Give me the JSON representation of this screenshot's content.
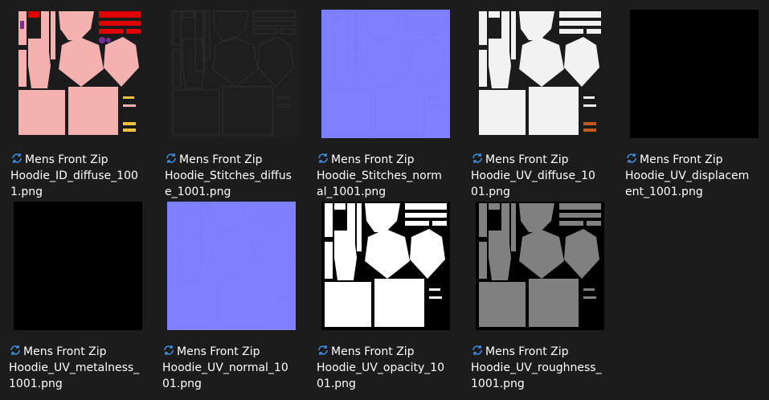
{
  "colors": {
    "background": "#1c1c1c",
    "text": "#ffffff",
    "sync_icon": "#3f8fe0",
    "id_pink": "#f5b0b0",
    "id_red": "#e00000",
    "id_purple": "#7b2e9a",
    "id_yellow": "#f0c040",
    "normal_blue": "#8080ff",
    "diffuse_white": "#f2f2f2",
    "roughness_gray": "#808080"
  },
  "icon": "sync-icon",
  "files": [
    {
      "lines": [
        "Mens Front Zip",
        "Hoodie_ID_diffuse_100",
        "1.png"
      ]
    },
    {
      "lines": [
        "Mens Front Zip",
        "Hoodie_Stitches_diffus",
        "e_1001.png"
      ]
    },
    {
      "lines": [
        "Mens Front Zip",
        "Hoodie_Stitches_norm",
        "al_1001.png"
      ]
    },
    {
      "lines": [
        "Mens Front Zip",
        "Hoodie_UV_diffuse_10",
        "01.png"
      ]
    },
    {
      "lines": [
        "Mens Front Zip",
        "Hoodie_UV_displacem",
        "ent_1001.png"
      ]
    },
    {
      "lines": [
        "Mens Front Zip",
        "Hoodie_UV_metalness_",
        "1001.png"
      ]
    },
    {
      "lines": [
        "Mens Front Zip",
        "Hoodie_UV_normal_10",
        "01.png"
      ]
    },
    {
      "lines": [
        "Mens Front Zip",
        "Hoodie_UV_opacity_10",
        "01.png"
      ]
    },
    {
      "lines": [
        "Mens Front Zip",
        "Hoodie_UV_roughness_",
        "1001.png"
      ]
    }
  ]
}
